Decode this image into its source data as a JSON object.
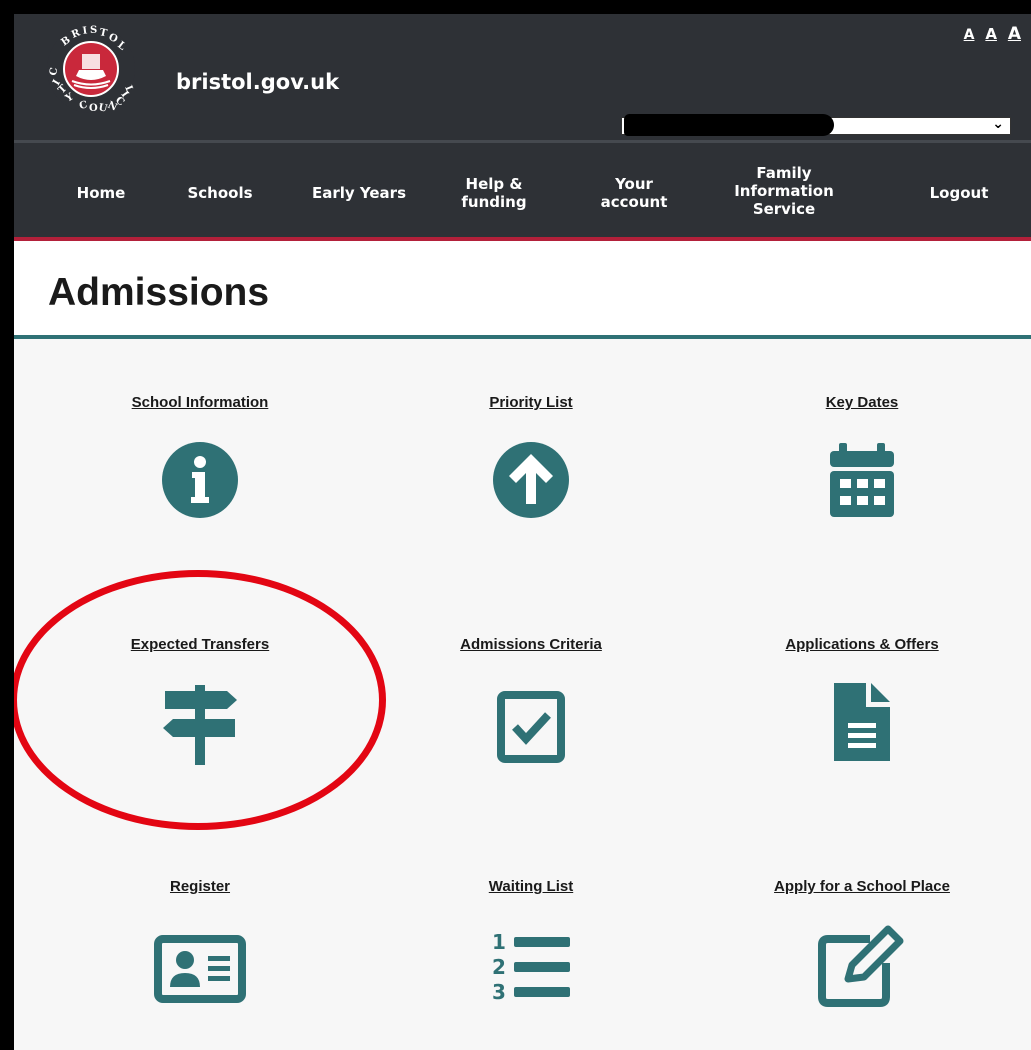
{
  "header": {
    "site_name": "bristol.gov.uk",
    "text_size": [
      "A",
      "A",
      "A"
    ]
  },
  "nav": {
    "items": [
      {
        "label": "Home"
      },
      {
        "label": "Schools"
      },
      {
        "label": "Early Years"
      },
      {
        "label": "Help &\nfunding"
      },
      {
        "label": "Your\naccount"
      },
      {
        "label": "Family\nInformation\nService"
      },
      {
        "label": "Logout"
      }
    ]
  },
  "page": {
    "title": "Admissions"
  },
  "tiles": [
    {
      "label": "School Information",
      "icon": "info-circle-icon"
    },
    {
      "label": "Priority List",
      "icon": "arrow-up-circle-icon"
    },
    {
      "label": "Key Dates",
      "icon": "calendar-icon"
    },
    {
      "label": "Expected Transfers",
      "icon": "signpost-icon"
    },
    {
      "label": "Admissions Criteria",
      "icon": "checkbox-icon"
    },
    {
      "label": "Applications & Offers",
      "icon": "document-icon"
    },
    {
      "label": "Register",
      "icon": "id-card-icon"
    },
    {
      "label": "Waiting List",
      "icon": "numbered-list-icon"
    },
    {
      "label": "Apply for a School Place",
      "icon": "edit-icon"
    }
  ],
  "colors": {
    "header_bg": "#2e3136",
    "accent_red": "#b3203a",
    "teal": "#2f7175",
    "annotation": "#e30613"
  }
}
